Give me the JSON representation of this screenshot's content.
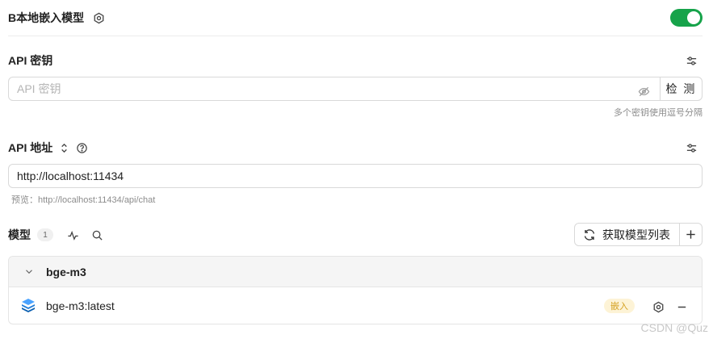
{
  "provider": {
    "title": "B本地嵌入模型",
    "enabled": true
  },
  "api_key": {
    "label": "API 密钥",
    "placeholder": "API 密钥",
    "value": "",
    "check_label": "检 测",
    "hint": "多个密钥使用逗号分隔"
  },
  "api_address": {
    "label": "API 地址",
    "value": "http://localhost:11434",
    "preview": "预览：http://localhost:11434/api/chat"
  },
  "models": {
    "label": "模型",
    "count": "1",
    "fetch_label": "获取模型列表",
    "groups": [
      {
        "name": "bge-m3",
        "items": [
          {
            "name": "bge-m3:latest",
            "tag": "嵌入"
          }
        ]
      }
    ]
  },
  "watermark": "CSDN @Quz",
  "colors": {
    "toggle_on": "#16a34a",
    "tag_bg": "#fdf3d6",
    "tag_text": "#d4a020"
  }
}
